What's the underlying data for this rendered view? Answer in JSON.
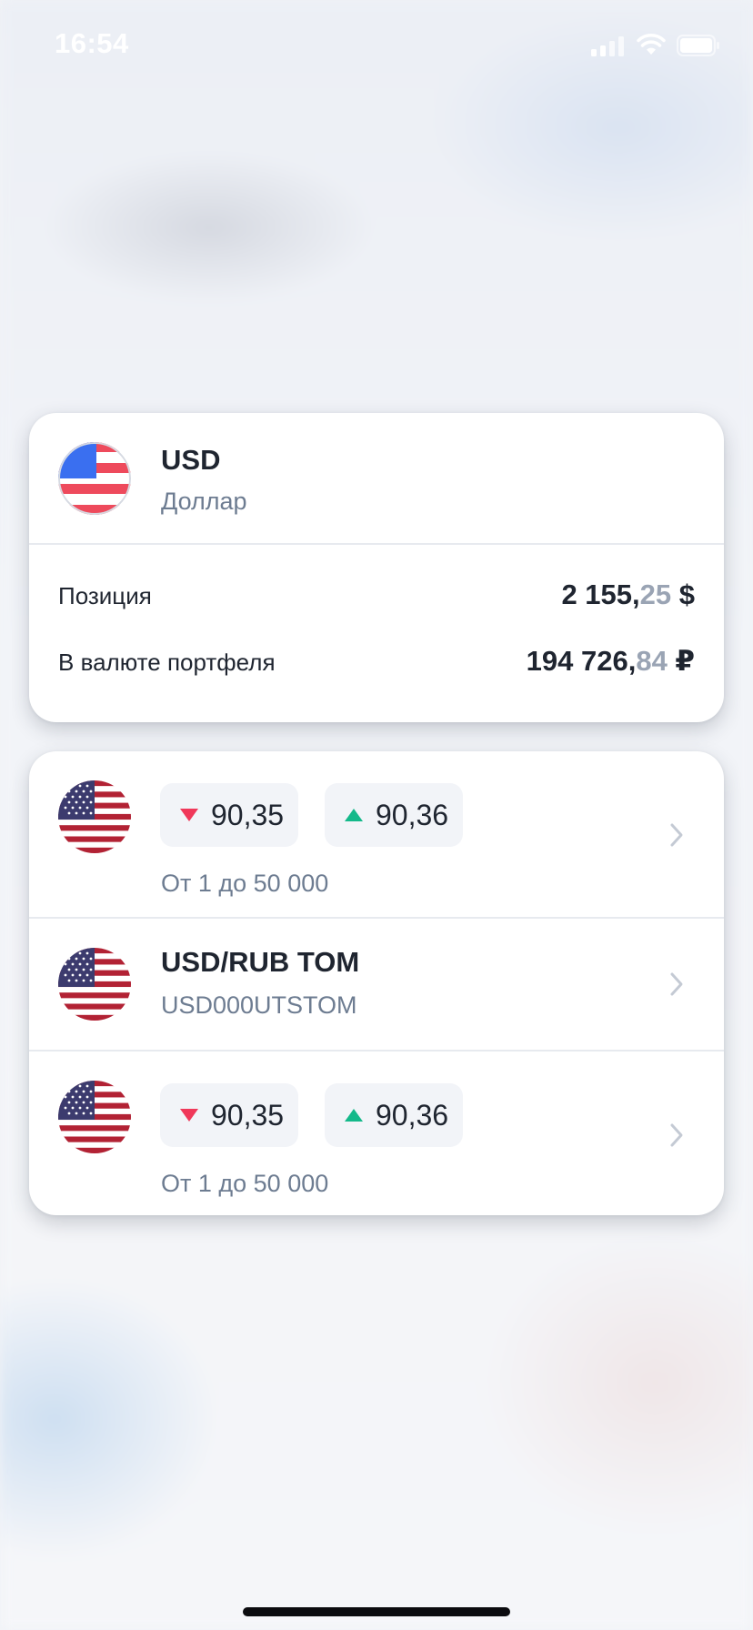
{
  "status_bar": {
    "time": "16:54",
    "icons": [
      "signal-icon",
      "wifi-icon",
      "battery-icon"
    ]
  },
  "currency_card": {
    "flag_icon": "us-flag-stylized-icon",
    "code": "USD",
    "name": "Доллар",
    "position": {
      "label": "Позиция",
      "whole": "2 155,",
      "fraction": "25",
      "symbol": " $"
    },
    "portfolio_value": {
      "label": "В валюте портфеля",
      "whole": "194 726,",
      "fraction": "84",
      "symbol": " ₽"
    }
  },
  "instruments": [
    {
      "flag_icon": "us-flag-icon",
      "sell_price": "90,35",
      "buy_price": "90,36",
      "range": "От 1 до 50 000"
    },
    {
      "flag_icon": "us-flag-icon",
      "title": "USD/RUB TOM",
      "ticker": "USD000UTSTOM"
    },
    {
      "flag_icon": "us-flag-icon",
      "sell_price": "90,35",
      "buy_price": "90,36",
      "range": "От 1 до 50 000"
    }
  ],
  "colors": {
    "down": "#f0385a",
    "up": "#14b98a",
    "text_primary": "#1f2530",
    "text_secondary": "#6d7c91",
    "fraction": "#9aa4b4",
    "pill_bg": "#f2f4f8"
  }
}
